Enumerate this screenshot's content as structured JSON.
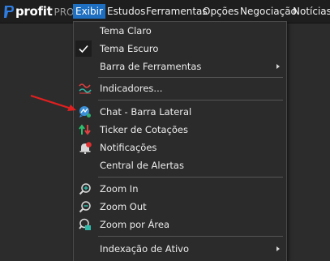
{
  "app": {
    "logo_text": "profit",
    "logo_sub": "PRO"
  },
  "menubar": {
    "items": [
      {
        "label": "Exibir"
      },
      {
        "label": "Estudos"
      },
      {
        "label": "Ferramentas"
      },
      {
        "label": "Opções"
      },
      {
        "label": "Negociação"
      },
      {
        "label": "Notícias"
      }
    ]
  },
  "dropdown": {
    "items": [
      {
        "label": "Tema Claro"
      },
      {
        "label": "Tema Escuro",
        "checked": true
      },
      {
        "label": "Barra de Ferramentas",
        "submenu": true
      },
      {
        "label": "Indicadores...",
        "icon": "indicators-icon"
      },
      {
        "label": "Chat - Barra Lateral",
        "icon": "chat-icon"
      },
      {
        "label": "Ticker de Cotações",
        "icon": "ticker-icon"
      },
      {
        "label": "Notificações",
        "icon": "bell-icon"
      },
      {
        "label": "Central de Alertas"
      },
      {
        "label": "Zoom In",
        "icon": "zoom-in-icon"
      },
      {
        "label": "Zoom Out",
        "icon": "zoom-out-icon"
      },
      {
        "label": "Zoom por Área",
        "icon": "zoom-area-icon"
      },
      {
        "label": "Indexação de Ativo",
        "submenu": true
      }
    ]
  },
  "colors": {
    "accent": "#1e6fc1",
    "annotation": "#e02020"
  }
}
